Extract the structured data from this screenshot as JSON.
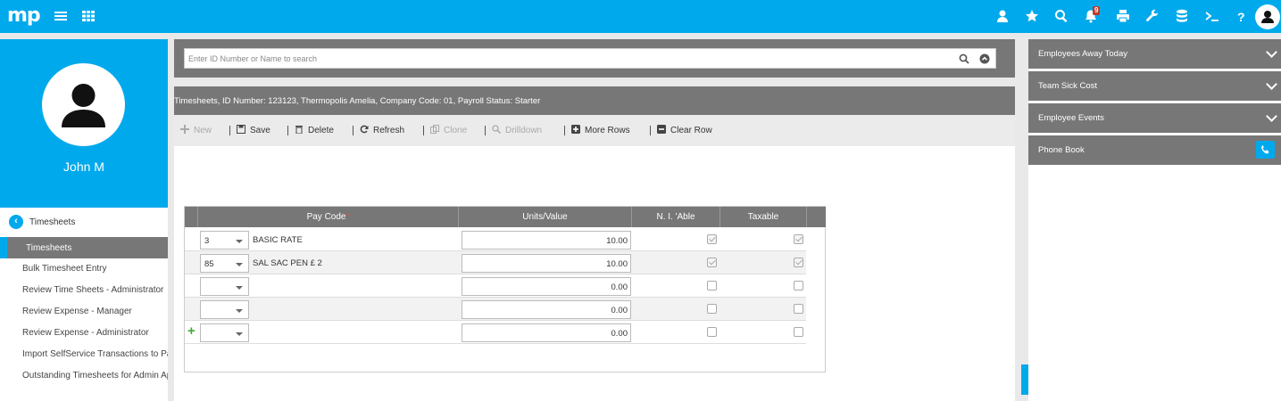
{
  "app": {
    "logo": "mp",
    "notification_count": "9"
  },
  "search": {
    "placeholder": "Enter ID Number or Name to search"
  },
  "profile": {
    "name": "John M"
  },
  "nav": {
    "section_title": "Timesheets",
    "active_item": "Timesheets",
    "items": [
      "Bulk Timesheet Entry",
      "Review Time Sheets - Administrator",
      "Review Expense - Manager",
      "Review Expense - Administrator",
      "Import SelfService Transactions to Pa",
      "Outstanding Timesheets for Admin Ap"
    ]
  },
  "record": {
    "title": "Timesheets, ID Number: 123123, Thermopolis Amelia, Company Code: 01, Payroll Status: Starter"
  },
  "toolbar": {
    "new": "New",
    "save": "Save",
    "delete": "Delete",
    "refresh": "Refresh",
    "clone": "Clone",
    "drilldown": "Drilldown",
    "more_rows": "More Rows",
    "clear_row": "Clear Row"
  },
  "grid": {
    "headers": {
      "pay_code": "Pay Code",
      "required_mark": "*",
      "units": "Units/Value",
      "ni": "N. I. 'Able",
      "taxable": "Taxable"
    },
    "rows": [
      {
        "code": "3",
        "desc": "BASIC RATE",
        "units": "10.00",
        "ni": true,
        "taxable": true
      },
      {
        "code": "85",
        "desc": "SAL SAC PEN £ 2",
        "units": "10.00",
        "ni": true,
        "taxable": true
      },
      {
        "code": "",
        "desc": "",
        "units": "0.00",
        "ni": false,
        "taxable": false
      },
      {
        "code": "",
        "desc": "",
        "units": "0.00",
        "ni": false,
        "taxable": false
      },
      {
        "code": "",
        "desc": "",
        "units": "0.00",
        "ni": false,
        "taxable": false
      }
    ]
  },
  "right_panel": {
    "away": "Employees Away Today",
    "sick": "Team Sick Cost",
    "events": "Employee Events",
    "phone": "Phone Book"
  },
  "colors": {
    "brand": "#00a9ec",
    "panel_gray": "#777777",
    "add_green": "#3aaa35",
    "badge_red": "#c0392b"
  }
}
